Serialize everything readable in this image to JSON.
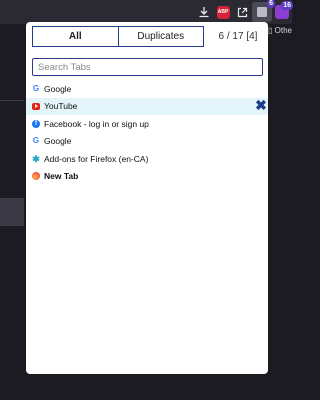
{
  "toolbar": {
    "icons": [
      "download-icon",
      "adblock-plus-icon",
      "open-external-icon",
      "tab-manager-icon",
      "extension-icon"
    ],
    "abp_label": "ABP",
    "tab_manager_badge": "6",
    "extension_badge": "16",
    "others_label": "Othe"
  },
  "popup": {
    "filter_tabs": {
      "all_label": "All",
      "duplicates_label": "Duplicates",
      "active": "All"
    },
    "count_text": "6 / 17 [4]",
    "search": {
      "placeholder": "Search Tabs",
      "value": ""
    },
    "tabs": [
      {
        "title": "Google",
        "favicon": "google-icon",
        "glyph": "G"
      },
      {
        "title": "YouTube",
        "favicon": "youtube-icon",
        "glyph": ""
      },
      {
        "title": "Facebook - log in or sign up",
        "favicon": "facebook-icon",
        "glyph": "f"
      },
      {
        "title": "Google",
        "favicon": "google-icon",
        "glyph": "G"
      },
      {
        "title": "Add-ons for Firefox (en-CA)",
        "favicon": "addons-icon",
        "glyph": "✱"
      },
      {
        "title": "New Tab",
        "favicon": "firefox-icon",
        "glyph": ""
      }
    ],
    "selected_tab_index": 1,
    "close_glyph": "✖",
    "colors": {
      "border_accent": "#1f3c88",
      "selected_row": "#e3f5f9",
      "close_icon": "#1f3c88"
    }
  }
}
